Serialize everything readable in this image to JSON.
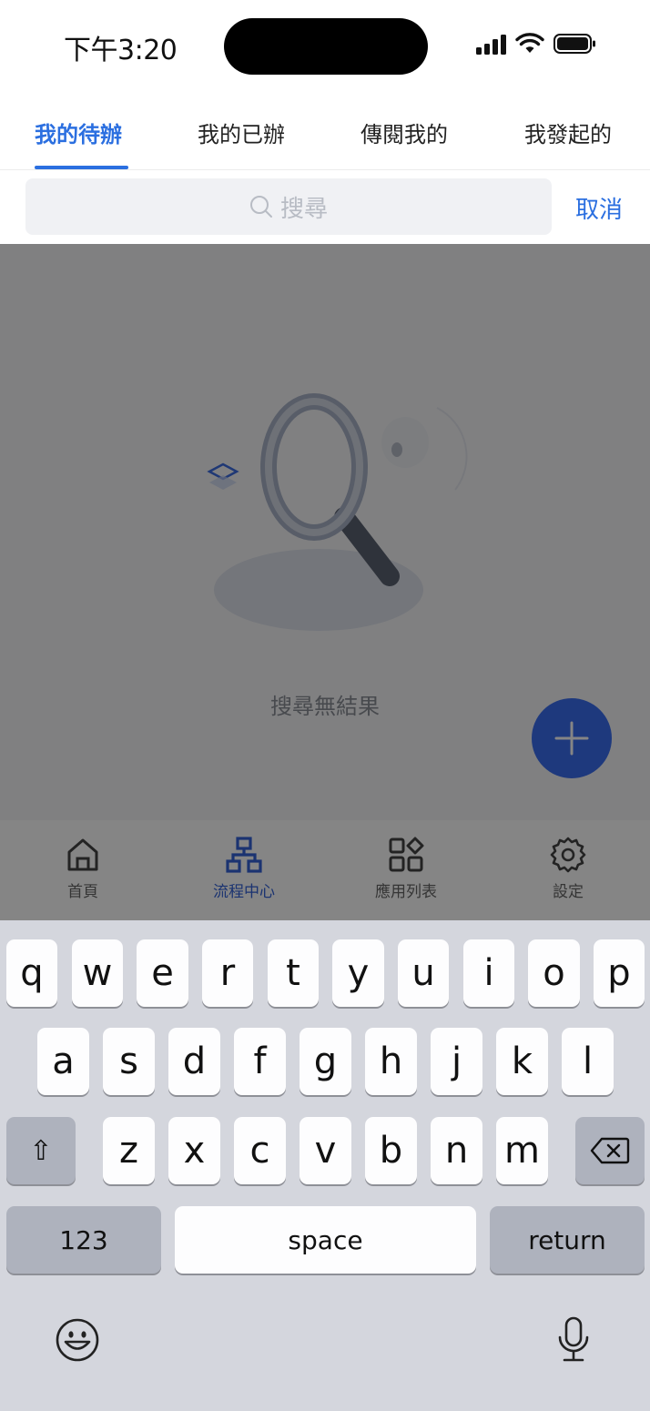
{
  "status_bar": {
    "time": "下午3:20"
  },
  "tabs": [
    {
      "label": "我的待辦",
      "active": true
    },
    {
      "label": "我的已辦",
      "active": false
    },
    {
      "label": "傳閱我的",
      "active": false
    },
    {
      "label": "我發起的",
      "active": false
    }
  ],
  "search": {
    "placeholder": "搜尋",
    "cancel_label": "取消"
  },
  "empty_state": {
    "message": "搜尋無結果"
  },
  "bottom_nav": [
    {
      "label": "首頁",
      "icon": "home-icon",
      "active": false
    },
    {
      "label": "流程中心",
      "icon": "workflow-icon",
      "active": true
    },
    {
      "label": "應用列表",
      "icon": "apps-icon",
      "active": false
    },
    {
      "label": "設定",
      "icon": "settings-icon",
      "active": false
    }
  ],
  "keyboard": {
    "row1": [
      "q",
      "w",
      "e",
      "r",
      "t",
      "y",
      "u",
      "i",
      "o",
      "p"
    ],
    "row2": [
      "a",
      "s",
      "d",
      "f",
      "g",
      "h",
      "j",
      "k",
      "l"
    ],
    "row3": [
      "z",
      "x",
      "c",
      "v",
      "b",
      "n",
      "m"
    ],
    "shift_symbol": "⇧",
    "numbers_label": "123",
    "space_label": "space",
    "return_label": "return"
  },
  "colors": {
    "accent": "#2b6fe0",
    "fab": "#3a6df0",
    "keyboard_bg": "#d4d6dd"
  }
}
